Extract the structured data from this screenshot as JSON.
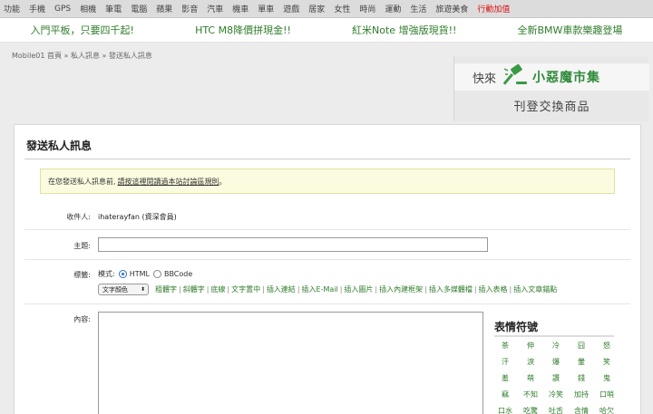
{
  "top_nav": [
    "功能",
    "手機",
    "GPS",
    "相機",
    "筆電",
    "電腦",
    "蘋果",
    "影音",
    "汽車",
    "機車",
    "單車",
    "遊戲",
    "居家",
    "女性",
    "時尚",
    "運動",
    "生活",
    "旅遊美食",
    "行動加值"
  ],
  "top_nav_highlight_color": "#dd1111",
  "promos": [
    "入門平板，只要四千起!",
    "HTC M8降價拼現金!!",
    "紅米Note 增強版現貨!!",
    "全新BMW車款樂趣登場"
  ],
  "breadcrumb": "Mobile01 首頁 » 私人訊息 » 發送私人訊息",
  "banner": {
    "prefix": "快來",
    "brand": "小惡魔市集",
    "tagline": "刊登交換商品",
    "brand_color": "#2f8a3a"
  },
  "page_title": "發送私人訊息",
  "notice": {
    "text": "在您發送私人訊息前,",
    "link": "請按這裡閱讀過本站討論區規則",
    "end": "。"
  },
  "form": {
    "recipient_label": "收件人:",
    "recipient_value": "ihaterayfan (資深會員)",
    "subject_label": "主題:",
    "subject_value": "",
    "tags_label": "標籤:",
    "mode_label": "模式:",
    "mode_html": "HTML",
    "mode_bbcode": "BBCode",
    "mode_selected": "HTML",
    "color_select": "文字顏色",
    "tools": [
      "粗體字",
      "斜體字",
      "底線",
      "文字置中",
      "插入連結",
      "插入E-Mail",
      "插入圖片",
      "插入內建框架",
      "插入多媒體檔",
      "插入表格",
      "插入文章錨點"
    ],
    "content_label": "內容:",
    "content_value": ""
  },
  "emoji": {
    "title": "表情符號",
    "items": [
      "茶",
      "伸",
      "冷",
      "囧",
      "怒",
      "汗",
      "淚",
      "爆",
      "暈",
      "笑",
      "羞",
      "萌",
      "讚",
      "錢",
      "鬼",
      "竊",
      "不知",
      "冷笑",
      "加持",
      "口哨",
      "口水",
      "吃驚",
      "吐舌",
      "含情",
      "哈欠"
    ]
  }
}
